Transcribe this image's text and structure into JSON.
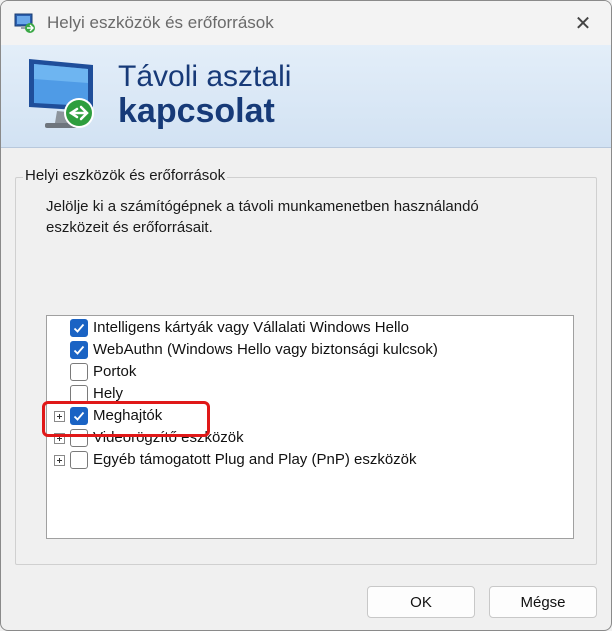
{
  "window": {
    "title": "Helyi eszközök és erőforrások",
    "close_glyph": "✕"
  },
  "banner": {
    "line1": "Távoli asztali",
    "line2": "kapcsolat"
  },
  "group": {
    "title": "Helyi eszközök és erőforrások",
    "description_line1": "Jelölje ki a számítógépnek a távoli munkamenetben használandó",
    "description_line2": "eszközeit és erőforrásait."
  },
  "devices": [
    {
      "label": "Intelligens kártyák vagy Vállalati Windows Hello",
      "checked": true,
      "expandable": false
    },
    {
      "label": "WebAuthn (Windows Hello vagy biztonsági kulcsok)",
      "checked": true,
      "expandable": false
    },
    {
      "label": "Portok",
      "checked": false,
      "expandable": false
    },
    {
      "label": "Hely",
      "checked": false,
      "expandable": false
    },
    {
      "label": "Meghajtók",
      "checked": true,
      "expandable": true
    },
    {
      "label": "Videorögzítő eszközök",
      "checked": false,
      "expandable": true
    },
    {
      "label": "Egyéb támogatott Plug and Play (PnP) eszközök",
      "checked": false,
      "expandable": true
    }
  ],
  "buttons": {
    "ok": "OK",
    "cancel": "Mégse"
  },
  "colors": {
    "accent": "#1a63c4",
    "banner_text": "#173a78",
    "highlight": "#e01818"
  },
  "icons": {
    "app": "remote-desktop-icon",
    "banner": "remote-desktop-monitor-icon",
    "close": "close-icon",
    "expand": "plus-expander-icon",
    "check": "checkmark-icon"
  }
}
